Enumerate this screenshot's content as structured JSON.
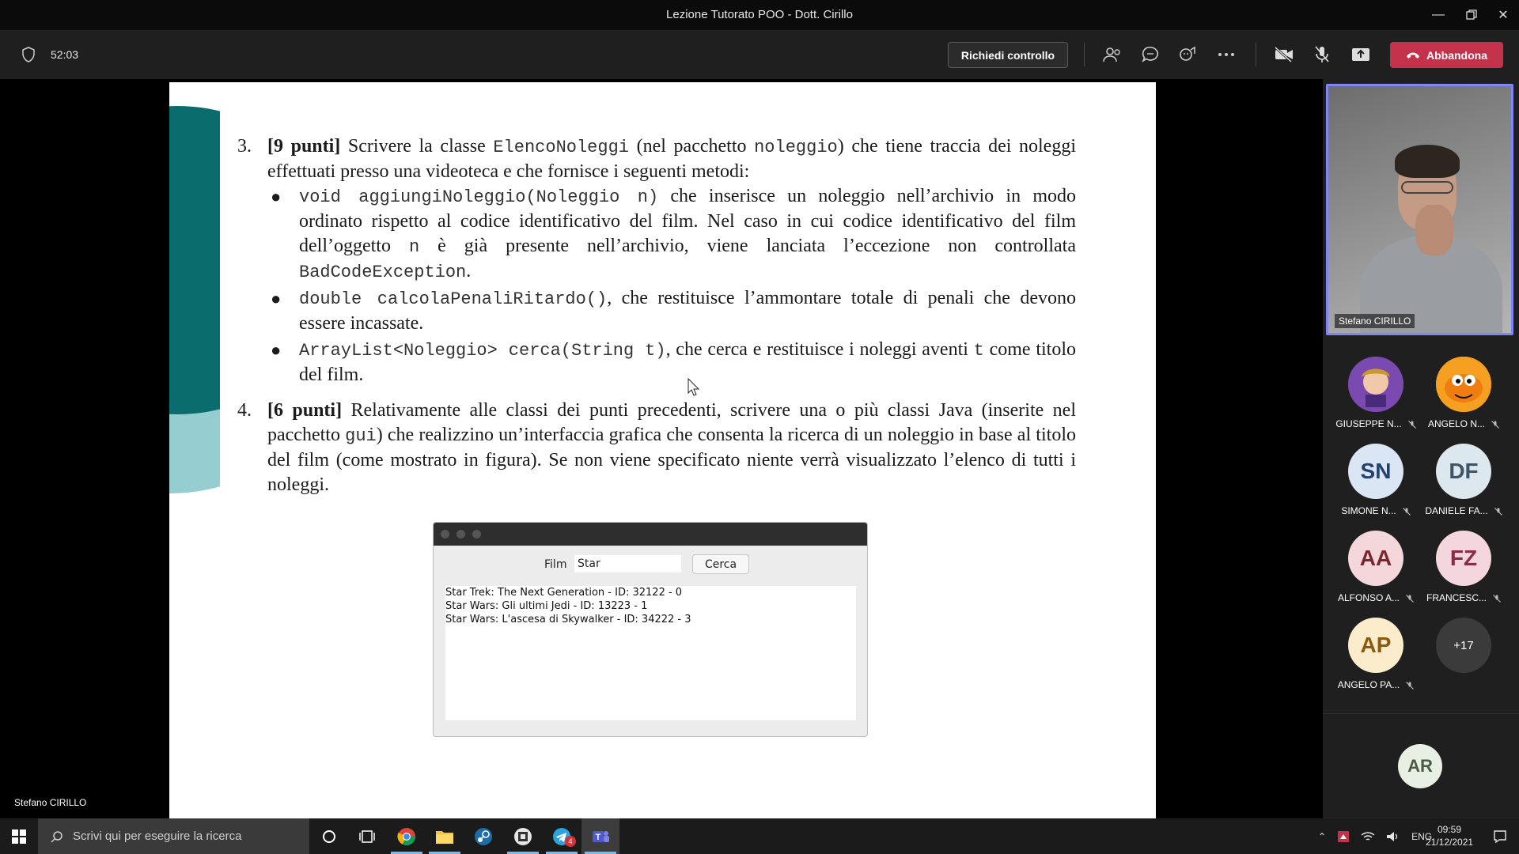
{
  "window": {
    "title": "Lezione Tutorato POO - Dott. Cirillo"
  },
  "meeting": {
    "timer": "52:03",
    "request_control_label": "Richiedi controllo",
    "leave_label": "Abbandona"
  },
  "presenter": {
    "name": "Stefano CIRILLO"
  },
  "slide": {
    "item3": {
      "number": "3.",
      "points": "[9 punti]",
      "intro_a": " Scrivere la classe ",
      "class_name": "ElencoNoleggi",
      "intro_b": " (nel pacchetto ",
      "package": "noleggio",
      "intro_c": ") che tiene traccia dei noleggi effettuati presso una videoteca e che fornisce i seguenti metodi:",
      "bullets": [
        {
          "code": "void aggiungiNoleggio(Noleggio n)",
          "text_a": " che inserisce un noleggio nell’archivio in modo ordinato rispetto al codice identificativo del film. Nel caso in cui codice identificativo del film dell’oggetto ",
          "code2": "n",
          "text_b": " è già presente nell’archivio, viene lanciata l’eccezione non controllata ",
          "code3": "BadCodeException",
          "text_c": "."
        },
        {
          "code": "double calcolaPenaliRitardo()",
          "text_a": ", che restituisce l’ammontare totale di penali che devono essere incassate."
        },
        {
          "code": "ArrayList<Noleggio> cerca(String t)",
          "text_a": ", che cerca e restituisce i noleggi aventi ",
          "code2": "t",
          "text_b": " come titolo del film."
        }
      ]
    },
    "item4": {
      "number": "4.",
      "points": "[6 punti]",
      "text_a": " Relativamente alle classi dei punti precedenti, scrivere una o più classi Java (inserite nel pacchetto ",
      "package": "gui",
      "text_b": ") che realizzino un’interfaccia grafica che consenta la ricerca di un noleggio in base al titolo del film (come mostrato in figura). Se non viene specificato niente verrà visualizzato l’elenco di tutti i noleggi."
    },
    "mini_app": {
      "field_label": "Film",
      "field_value": "Star",
      "button_label": "Cerca",
      "results": [
        "Star Trek: The Next Generation - ID: 32122 - 0",
        "Star Wars: Gli ultimi Jedi - ID: 13223 - 1",
        "Star Wars: L'ascesa di Skywalker - ID: 34222 - 3"
      ]
    }
  },
  "participants": {
    "video_name": "Stefano CIRILLO",
    "tiles": [
      {
        "initials": "",
        "name": "GIUSEPPE N...",
        "bg": "#6b3fa0",
        "fg": "#ffffff"
      },
      {
        "initials": "",
        "name": "ANGELO N...",
        "bg": "#f08a1c",
        "fg": "#ffffff"
      },
      {
        "initials": "SN",
        "name": "SIMONE N...",
        "bg": "#dbe6f4",
        "fg": "#24406e"
      },
      {
        "initials": "DF",
        "name": "DANIELE FA...",
        "bg": "#dde7ee",
        "fg": "#3d5566"
      },
      {
        "initials": "AA",
        "name": "ALFONSO A...",
        "bg": "#f4d7da",
        "fg": "#7a2530"
      },
      {
        "initials": "FZ",
        "name": "FRANCESC...",
        "bg": "#f4d7de",
        "fg": "#8a2c45"
      },
      {
        "initials": "AP",
        "name": "ANGELO PA...",
        "bg": "#fbeccc",
        "fg": "#8a5a10"
      },
      {
        "initials": "+17",
        "name": "",
        "bg": "#3b3b3b",
        "fg": "#ffffff"
      }
    ],
    "extra": {
      "initials": "AR"
    }
  },
  "taskbar": {
    "search_placeholder": "Scrivi qui per eseguire la ricerca",
    "language": "ENG",
    "time": "09:59",
    "date": "21/12/2021",
    "telegram_badge": "4"
  }
}
